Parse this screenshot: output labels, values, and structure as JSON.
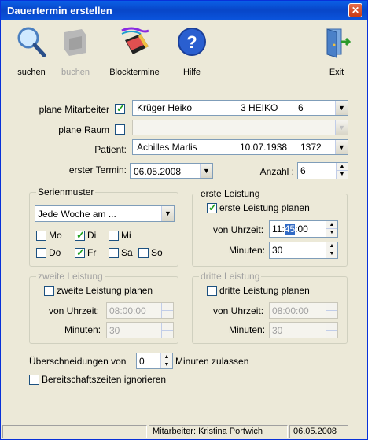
{
  "window": {
    "title": "Dauertermin erstellen"
  },
  "toolbar": {
    "search": "suchen",
    "book": "buchen",
    "blocks": "Blocktermine",
    "help": "Hilfe",
    "exit": "Exit"
  },
  "form": {
    "plane_mitarbeiter_label": "plane Mitarbeiter",
    "mitarbeiter": {
      "name": "Krüger Heiko",
      "code": "3 HEIKO",
      "nr": "6"
    },
    "plane_raum_label": "plane Raum",
    "patient_label": "Patient:",
    "patient": {
      "name": "Achilles Marlis",
      "dob": "10.07.1938",
      "nr": "1372"
    },
    "erster_termin_label": "erster Termin:",
    "erster_termin": "06.05.2008",
    "anzahl_label": "Anzahl :",
    "anzahl": "6"
  },
  "serienmuster": {
    "title": "Serienmuster",
    "mode": "Jede Woche am ...",
    "days": [
      {
        "label": "Mo",
        "checked": false
      },
      {
        "label": "Di",
        "checked": true
      },
      {
        "label": "Mi",
        "checked": false
      },
      {
        "label": "Do",
        "checked": false
      },
      {
        "label": "Fr",
        "checked": true
      },
      {
        "label": "Sa",
        "checked": false
      },
      {
        "label": "So",
        "checked": false
      }
    ]
  },
  "erste_leistung": {
    "title": "erste Leistung",
    "check_label": "erste Leistung planen",
    "checked": true,
    "von_label": "von Uhrzeit:",
    "von_pre": "11:",
    "von_sel": "45",
    "von_post": ":00",
    "min_label": "Minuten:",
    "minuten": "30"
  },
  "zweite_leistung": {
    "title": "zweite Leistung",
    "check_label": "zweite Leistung planen",
    "von_label": "von Uhrzeit:",
    "von": "08:00:00",
    "min_label": "Minuten:",
    "minuten": "30"
  },
  "dritte_leistung": {
    "title": "dritte Leistung",
    "check_label": "dritte Leistung  planen",
    "von_label": "von Uhrzeit:",
    "von": "08:00:00",
    "min_label": "Minuten:",
    "minuten": "30"
  },
  "overlap": {
    "pre": "Überschneidungen von",
    "value": "0",
    "post": "Minuten zulassen"
  },
  "bereitschaft": {
    "label": "Bereitschaftszeiten ignorieren"
  },
  "status": {
    "mitarbeiter": "Mitarbeiter:  Kristina Portwich",
    "date": "06.05.2008"
  }
}
